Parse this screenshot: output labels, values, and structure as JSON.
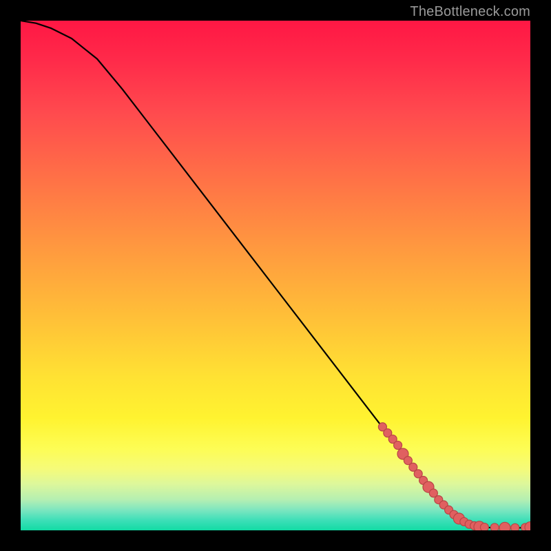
{
  "watermark": "TheBottleneck.com",
  "chart_data": {
    "type": "line",
    "title": "",
    "xlabel": "",
    "ylabel": "",
    "xlim": [
      0,
      100
    ],
    "ylim": [
      0,
      100
    ],
    "grid": false,
    "legend": false,
    "series": [
      {
        "name": "bottleneck-curve",
        "x": [
          0,
          3,
          6,
          10,
          15,
          20,
          25,
          30,
          35,
          40,
          45,
          50,
          55,
          60,
          65,
          70,
          75,
          80,
          82,
          84,
          86,
          88,
          90,
          92,
          94,
          96,
          98,
          100
        ],
        "y": [
          100,
          99.5,
          98.5,
          96.5,
          92.5,
          86.5,
          80,
          73.5,
          67,
          60.5,
          54,
          47.5,
          41,
          34.5,
          28,
          21.5,
          15,
          8.5,
          6.0,
          4.0,
          2.3,
          1.2,
          0.7,
          0.55,
          0.5,
          0.5,
          0.5,
          0.6
        ]
      }
    ],
    "highlight_points": {
      "name": "highlight-dots",
      "x": [
        71,
        72,
        73,
        74,
        75,
        76,
        77,
        78,
        79,
        80,
        81,
        82,
        83,
        84,
        85,
        86,
        87,
        88,
        89,
        90,
        91,
        93,
        95,
        97,
        99,
        100
      ],
      "y": [
        20.3,
        19.1,
        17.9,
        16.7,
        15.0,
        13.7,
        12.4,
        11.1,
        9.8,
        8.5,
        7.3,
        6.0,
        5.0,
        4.0,
        3.1,
        2.3,
        1.7,
        1.2,
        0.9,
        0.7,
        0.6,
        0.55,
        0.5,
        0.5,
        0.55,
        0.6
      ],
      "r": [
        6,
        6,
        6,
        6,
        8,
        6,
        6,
        6,
        6,
        8,
        6,
        6,
        6,
        6,
        6,
        8,
        6,
        6,
        6,
        8,
        6,
        6,
        8,
        6,
        6,
        8
      ]
    }
  }
}
